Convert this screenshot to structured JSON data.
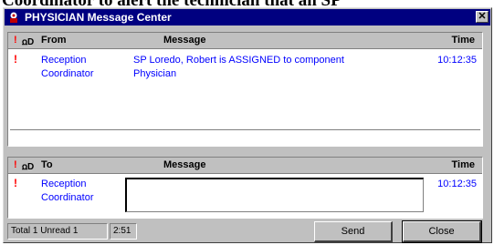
{
  "heading_fragment": "Coordinator to alert the technician that an SP",
  "window": {
    "title": "PHYSICIAN Message Center"
  },
  "inbox": {
    "columns": {
      "priority": "!",
      "icon": "ꭥD",
      "from": "From",
      "message": "Message",
      "time": "Time"
    },
    "rows": [
      {
        "priority": "!",
        "from_line1": "Reception",
        "from_line2": "Coordinator",
        "message_line1": "SP Loredo, Robert  is ASSIGNED to component",
        "message_line2": "Physician",
        "time": "10:12:35"
      }
    ]
  },
  "outbox": {
    "columns": {
      "priority": "!",
      "icon": "ꭥD",
      "to": "To",
      "message": "Message",
      "time": "Time"
    },
    "row": {
      "priority": "!",
      "to_line1": "Reception",
      "to_line2": "Coordinator",
      "message_value": "",
      "time": "10:12:35"
    }
  },
  "status": {
    "counts": "Total 1 Unread 1",
    "seconds": "2:51"
  },
  "buttons": {
    "send": "Send",
    "close": "Close"
  },
  "colors": {
    "title_bar": "#000080",
    "text_link": "#0000ff",
    "priority": "#ff0000",
    "face": "#c0c0c0"
  },
  "icons": [
    "app-icon",
    "close-icon",
    "phone-icon"
  ]
}
